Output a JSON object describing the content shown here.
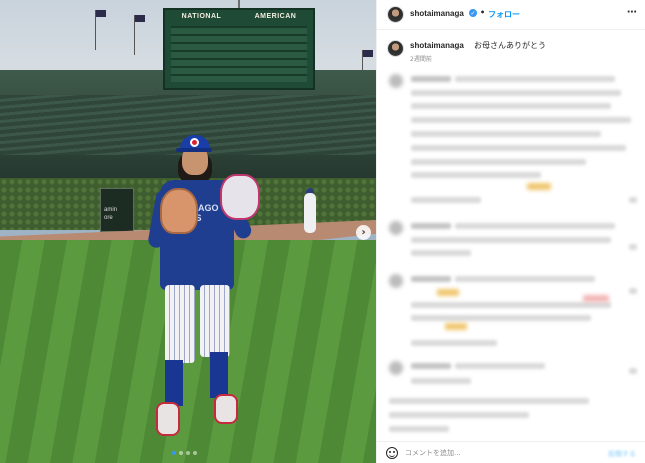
{
  "header": {
    "username": "shotaimanaga",
    "separator": "•",
    "follow_label": "フォロー",
    "more_icon": "more-horizontal-icon"
  },
  "caption": {
    "username": "shotaimanaga",
    "text": "お母さんありがとう",
    "time_ago": "2週間前"
  },
  "comment_box": {
    "placeholder": "コメントを追加...",
    "post_label": "投稿する",
    "emoji_icon": "emoji-icon"
  },
  "photo": {
    "scoreboard": {
      "left_label": "NATIONAL",
      "right_label": "AMERICAN"
    },
    "jersey_text_line1": "CHICAGO",
    "jersey_text_line2": "CUBS",
    "wall_sign_line1": "amin",
    "wall_sign_line2": "ore",
    "carousel_dots": 4,
    "active_dot": 1,
    "next_icon": "chevron-right-icon"
  },
  "colors": {
    "accent": "#0095f6",
    "verified": "#3897f0",
    "text": "#262626",
    "muted": "#8e8e8e"
  }
}
